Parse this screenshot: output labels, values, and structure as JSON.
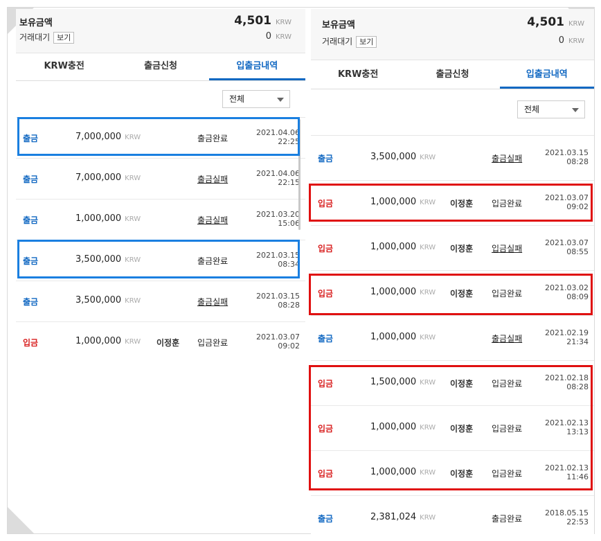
{
  "left": {
    "balance": {
      "title": "보유금액",
      "amount": "4,501",
      "unit": "KRW",
      "pending_label": "거래대기",
      "view_label": "보기",
      "pending_amount": "0",
      "pending_unit": "KRW"
    },
    "tabs": [
      "KRW충전",
      "출금신청",
      "입출금내역"
    ],
    "active_tab": 2,
    "filter": "전체",
    "rows": [
      {
        "type": "출금",
        "kind": "out",
        "amount": "7,000,000",
        "unit": "KRW",
        "name": "",
        "status": "출금완료",
        "fail": false,
        "date": "2021.04.06",
        "time": "22:25"
      },
      {
        "type": "출금",
        "kind": "out",
        "amount": "7,000,000",
        "unit": "KRW",
        "name": "",
        "status": "출금실패",
        "fail": true,
        "date": "2021.04.06",
        "time": "22:15"
      },
      {
        "type": "출금",
        "kind": "out",
        "amount": "1,000,000",
        "unit": "KRW",
        "name": "",
        "status": "출금실패",
        "fail": true,
        "date": "2021.03.20",
        "time": "15:06"
      },
      {
        "type": "출금",
        "kind": "out",
        "amount": "3,500,000",
        "unit": "KRW",
        "name": "",
        "status": "출금완료",
        "fail": false,
        "date": "2021.03.15",
        "time": "08:34"
      },
      {
        "type": "출금",
        "kind": "out",
        "amount": "3,500,000",
        "unit": "KRW",
        "name": "",
        "status": "출금실패",
        "fail": true,
        "date": "2021.03.15",
        "time": "08:28"
      },
      {
        "type": "입금",
        "kind": "in",
        "amount": "1,000,000",
        "unit": "KRW",
        "name": "이정훈",
        "status": "입금완료",
        "fail": false,
        "date": "2021.03.07",
        "time": "09:02"
      }
    ]
  },
  "right": {
    "balance": {
      "title": "보유금액",
      "amount": "4,501",
      "unit": "KRW",
      "pending_label": "거래대기",
      "view_label": "보기",
      "pending_amount": "0",
      "pending_unit": "KRW"
    },
    "tabs": [
      "KRW충전",
      "출금신청",
      "입출금내역"
    ],
    "active_tab": 2,
    "filter": "전체",
    "rows": [
      {
        "type": "출금",
        "kind": "out",
        "amount": "3,500,000",
        "unit": "KRW",
        "name": "",
        "status": "출금실패",
        "fail": true,
        "date": "2021.03.15",
        "time": "08:28"
      },
      {
        "type": "입금",
        "kind": "in",
        "amount": "1,000,000",
        "unit": "KRW",
        "name": "이정훈",
        "status": "입금완료",
        "fail": false,
        "date": "2021.03.07",
        "time": "09:02"
      },
      {
        "type": "입금",
        "kind": "in",
        "amount": "1,000,000",
        "unit": "KRW",
        "name": "이정훈",
        "status": "입금실패",
        "fail": true,
        "date": "2021.03.07",
        "time": "08:55"
      },
      {
        "type": "입금",
        "kind": "in",
        "amount": "1,000,000",
        "unit": "KRW",
        "name": "이정훈",
        "status": "입금완료",
        "fail": false,
        "date": "2021.03.02",
        "time": "08:09"
      },
      {
        "type": "출금",
        "kind": "out",
        "amount": "1,000,000",
        "unit": "KRW",
        "name": "",
        "status": "출금실패",
        "fail": true,
        "date": "2021.02.19",
        "time": "21:34"
      },
      {
        "type": "입금",
        "kind": "in",
        "amount": "1,500,000",
        "unit": "KRW",
        "name": "이정훈",
        "status": "입금완료",
        "fail": false,
        "date": "2021.02.18",
        "time": "08:28"
      },
      {
        "type": "입금",
        "kind": "in",
        "amount": "1,000,000",
        "unit": "KRW",
        "name": "이정훈",
        "status": "입금완료",
        "fail": false,
        "date": "2021.02.13",
        "time": "13:13"
      },
      {
        "type": "입금",
        "kind": "in",
        "amount": "1,000,000",
        "unit": "KRW",
        "name": "이정훈",
        "status": "입금완료",
        "fail": false,
        "date": "2021.02.13",
        "time": "11:46"
      },
      {
        "type": "출금",
        "kind": "out",
        "amount": "2,381,024",
        "unit": "KRW",
        "name": "",
        "status": "출금완료",
        "fail": false,
        "date": "2018.05.15",
        "time": "22:53"
      }
    ]
  },
  "colors": {
    "out": "#1168c2",
    "in": "#d81e1e",
    "highlight_blue": "#1a7fe0",
    "highlight_red": "#e01010"
  }
}
